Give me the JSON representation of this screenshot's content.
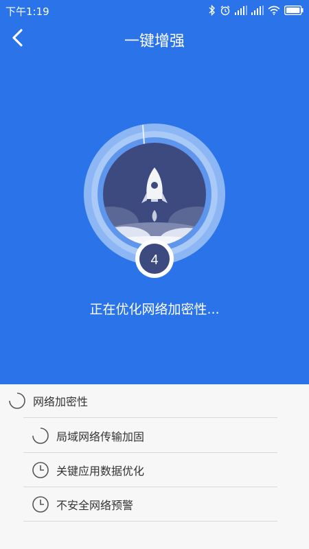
{
  "status_bar": {
    "time": "下午1:19",
    "battery_percent": 100,
    "icons": [
      "bluetooth-icon",
      "alarm-icon",
      "signal-icon",
      "signal-icon",
      "wifi-icon",
      "battery-icon"
    ]
  },
  "header": {
    "title": "一键增强",
    "back_icon": "back-arrow-icon"
  },
  "progress": {
    "count": "4",
    "current_text": "正在优化网络加密性..."
  },
  "tasks": {
    "main": {
      "label": "网络加密性",
      "state": "in-progress"
    },
    "items": [
      {
        "label": "局域网络传输加固",
        "state": "in-progress"
      },
      {
        "label": "关键应用数据优化",
        "state": "pending"
      },
      {
        "label": "不安全网络预警",
        "state": "pending"
      }
    ]
  },
  "colors": {
    "background_blue": "#2a73e8",
    "ring_light": "#8db6f4",
    "circle_dark": "#3c4a7f",
    "list_background": "#f7f7f7"
  }
}
